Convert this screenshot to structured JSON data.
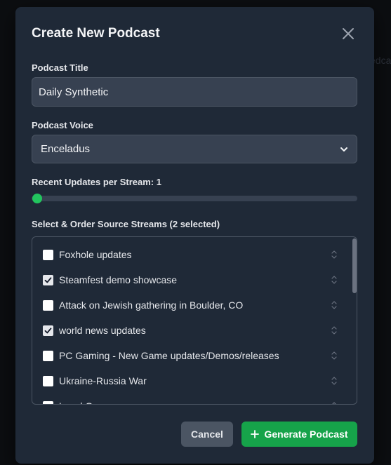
{
  "background": {
    "partial_text": "edca"
  },
  "modal": {
    "title": "Create New Podcast",
    "close_icon": "close-icon"
  },
  "form": {
    "title_label": "Podcast Title",
    "title_value": "Daily Synthetic",
    "voice_label": "Podcast Voice",
    "voice_value": "Enceladus",
    "updates_label": "Recent Updates per Stream: 1",
    "updates_value": 1,
    "streams_label": "Select & Order Source Streams (2 selected)"
  },
  "streams": [
    {
      "label": "Foxhole updates",
      "checked": false
    },
    {
      "label": "Steamfest demo showcase",
      "checked": true
    },
    {
      "label": "Attack on Jewish gathering in Boulder, CO",
      "checked": false
    },
    {
      "label": "world news updates",
      "checked": true
    },
    {
      "label": "PC Gaming - New Game updates/Demos/releases",
      "checked": false
    },
    {
      "label": "Ukraine-Russia War",
      "checked": false
    },
    {
      "label": "Local Gov...",
      "checked": false
    }
  ],
  "footer": {
    "cancel_label": "Cancel",
    "generate_label": "Generate Podcast",
    "generate_icon": "plus-icon"
  },
  "colors": {
    "modal_bg": "#1f2937",
    "input_bg": "#374151",
    "accent_green": "#16a34a",
    "slider_thumb": "#22c55e",
    "cancel_bg": "#4b5563"
  }
}
